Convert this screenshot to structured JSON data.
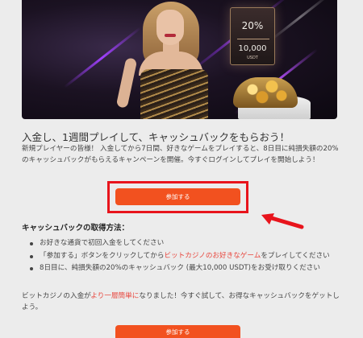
{
  "banner": {
    "promo_card": {
      "percent": "20%",
      "amount": "10,000",
      "unit": "USDT"
    }
  },
  "headline": "入金し、1週間プレイして、キャッシュバックをもらおう！",
  "intro": "新規プレイヤーの皆様！ 入金してから7日間、好きなゲームをプレイすると、8日目に純損失額の20%のキャッシュバックがもらえるキャンペーンを開催。今すぐログインしてプレイを開始しよう！",
  "cta_label": "参加する",
  "how_to": {
    "title": "キャッシュバックの取得方法：",
    "steps": [
      {
        "text": "お好きな通貨で初回入金をしてください"
      },
      {
        "before": "「参加する」ボタンをクリックしてから",
        "link": "ビットカジノのお好きなゲーム",
        "after": "をプレイしてください"
      },
      {
        "text": "8日目に、純損失額の20%のキャッシュバック (最大10,000 USDT)をお受け取りください"
      }
    ]
  },
  "outro": {
    "before": "ビットカジノの入金が",
    "highlight": "より一層簡単に",
    "after": "なりました！今すぐ試して、お得なキャッシュバックをゲットしよう。"
  },
  "cta2_label": "参加する",
  "colors": {
    "button": "#f2511f",
    "annotation": "#e8141c",
    "link": "#e8453c"
  }
}
